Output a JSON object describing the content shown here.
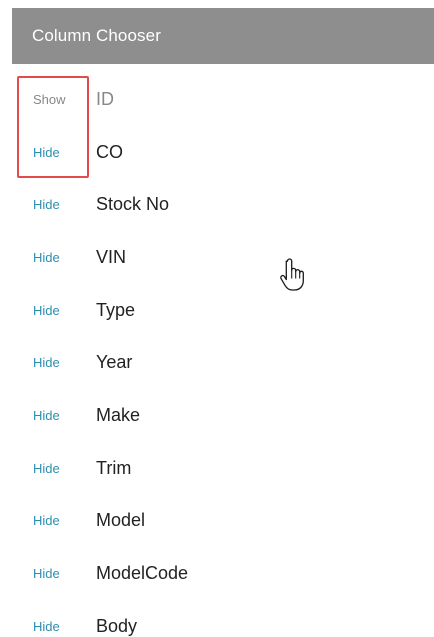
{
  "panel": {
    "title": "Column Chooser"
  },
  "columns": [
    {
      "toggle": "Show",
      "name": "ID",
      "visible": false
    },
    {
      "toggle": "Hide",
      "name": "CO",
      "visible": true
    },
    {
      "toggle": "Hide",
      "name": "Stock No",
      "visible": true
    },
    {
      "toggle": "Hide",
      "name": "VIN",
      "visible": true
    },
    {
      "toggle": "Hide",
      "name": "Type",
      "visible": true
    },
    {
      "toggle": "Hide",
      "name": "Year",
      "visible": true
    },
    {
      "toggle": "Hide",
      "name": "Make",
      "visible": true
    },
    {
      "toggle": "Hide",
      "name": "Trim",
      "visible": true
    },
    {
      "toggle": "Hide",
      "name": "Model",
      "visible": true
    },
    {
      "toggle": "Hide",
      "name": "ModelCode",
      "visible": true
    },
    {
      "toggle": "Hide",
      "name": "Body",
      "visible": true
    }
  ],
  "colors": {
    "header_bg": "#8e8e8e",
    "link_active": "#2d8fb0",
    "link_inactive": "#888888",
    "highlight": "#e34a4a"
  },
  "icons": {
    "cursor": "hand-pointer-icon"
  }
}
